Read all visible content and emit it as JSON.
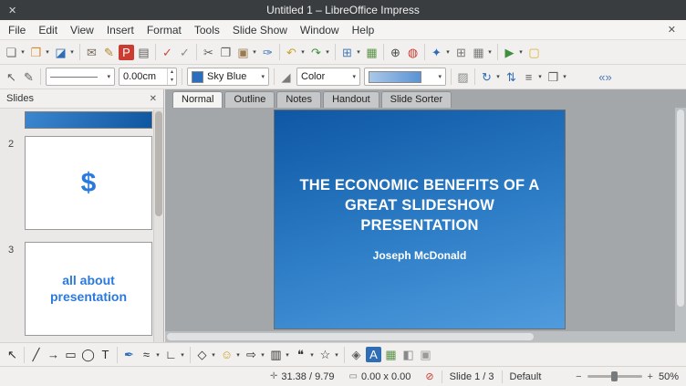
{
  "ui": {
    "caret": "▾",
    "caret_up": "▴"
  },
  "titlebar": {
    "title": "Untitled 1 – LibreOffice Impress",
    "close_glyph": "✕"
  },
  "menubar": {
    "items": [
      "File",
      "Edit",
      "View",
      "Insert",
      "Format",
      "Tools",
      "Slide Show",
      "Window",
      "Help"
    ],
    "close_glyph": "✕"
  },
  "toolbar_standard": {
    "group1": [
      {
        "name": "new-presentation-icon",
        "glyph": "❏",
        "color": "#6d6d6d",
        "caret": true
      },
      {
        "name": "open-icon",
        "glyph": "❒",
        "color": "#d78a2e",
        "caret": true
      },
      {
        "name": "save-icon",
        "glyph": "◪",
        "color": "#2f6db4",
        "caret": true
      }
    ],
    "group2": [
      {
        "name": "email-icon",
        "glyph": "✉",
        "color": "#75695a"
      },
      {
        "name": "edit-file-icon",
        "glyph": "✎",
        "color": "#b5882e"
      },
      {
        "name": "export-pdf-icon",
        "glyph": "P",
        "color": "#ffffff",
        "bg": "#cc3b2f"
      },
      {
        "name": "print-icon",
        "glyph": "▤",
        "color": "#5e5e5e"
      }
    ],
    "group3": [
      {
        "name": "spelling-icon",
        "glyph": "✓",
        "color": "#c04a3a"
      },
      {
        "name": "auto-spellcheck-icon",
        "glyph": "✓",
        "color": "#8a8a8a"
      }
    ],
    "group4": [
      {
        "name": "cut-icon",
        "glyph": "✂",
        "color": "#5e5e5e"
      },
      {
        "name": "copy-icon",
        "glyph": "❐",
        "color": "#5e5e5e"
      },
      {
        "name": "paste-icon",
        "glyph": "▣",
        "color": "#9a7b4f",
        "caret": true
      },
      {
        "name": "clone-formatting-icon",
        "glyph": "✑",
        "color": "#2f6db4"
      }
    ],
    "group5": [
      {
        "name": "undo-icon",
        "glyph": "↶",
        "color": "#c9a227",
        "caret": true
      },
      {
        "name": "redo-icon",
        "glyph": "↷",
        "color": "#3f8f3f",
        "caret": true
      }
    ],
    "group6": [
      {
        "name": "insert-table-icon",
        "glyph": "⊞",
        "color": "#4a7ab5",
        "caret": true
      },
      {
        "name": "insert-image-icon",
        "glyph": "▦",
        "color": "#5d9348"
      }
    ],
    "group7": [
      {
        "name": "zoom-icon",
        "glyph": "⊕",
        "color": "#4a4a4a"
      },
      {
        "name": "gallery-icon",
        "glyph": "◍",
        "color": "#cc3b2f"
      }
    ],
    "group8": [
      {
        "name": "navigator-icon",
        "glyph": "✦",
        "color": "#2f6db4",
        "caret": true
      },
      {
        "name": "display-grid-icon",
        "glyph": "⊞",
        "color": "#7a7a7a"
      },
      {
        "name": "helplines-icon",
        "glyph": "▦",
        "color": "#7a7a7a",
        "caret": true
      }
    ],
    "group9": [
      {
        "name": "start-slideshow-icon",
        "glyph": "▶",
        "color": "#3f8f3f",
        "caret": true
      },
      {
        "name": "insert-comment-icon",
        "glyph": "▢",
        "color": "#d9b036"
      }
    ]
  },
  "toolbar_line_fill": {
    "group1": [
      {
        "name": "select-icon",
        "glyph": "↖",
        "color": "#5e5e5e"
      },
      {
        "name": "edit-points-icon",
        "glyph": "✎",
        "color": "#5e5e5e"
      }
    ],
    "line_width_value": "0.00cm",
    "line_color": {
      "label": "Sky Blue",
      "hex": "#2a6fbf"
    },
    "fill_can_glyph": "◢",
    "fill_type_label": "Color",
    "fill_gradient": {
      "from": "#aac8e8",
      "to": "#5b93d5"
    },
    "group2": [
      {
        "name": "shadow-icon",
        "glyph": "▨",
        "color": "#8a8a8a"
      }
    ],
    "group3": [
      {
        "name": "rotate-icon",
        "glyph": "↻",
        "color": "#2f6db4",
        "caret": true
      },
      {
        "name": "flip-icon",
        "glyph": "⇅",
        "color": "#2f6db4"
      },
      {
        "name": "align-objects-icon",
        "glyph": "≡",
        "color": "#5e5e5e",
        "caret": true
      },
      {
        "name": "arrange-icon",
        "glyph": "❒",
        "color": "#5e5e5e",
        "caret": true
      }
    ],
    "group4": [
      {
        "name": "double-chevron-icon",
        "glyph": "«»",
        "color": "#4a7ab5"
      }
    ]
  },
  "view_tabs": {
    "tabs": [
      "Normal",
      "Outline",
      "Notes",
      "Handout",
      "Slide Sorter"
    ]
  },
  "slides_panel": {
    "title": "Slides",
    "close_glyph": "✕",
    "slide2_number": "2",
    "slide2_text": "$",
    "slide3_number": "3",
    "slide3_text": "all about presentation"
  },
  "slide": {
    "title": "THE ECONOMIC BENEFITS OF A GREAT SLIDESHOW PRESENTATION",
    "subtitle": "Joseph McDonald",
    "gradient_from": "#0e57a4",
    "gradient_to": "#4f9bdd"
  },
  "drawing_toolbar": {
    "group1": [
      {
        "name": "select-arrow-icon",
        "glyph": "↖",
        "color": "#2b2b2b"
      }
    ],
    "group2": [
      {
        "name": "line-icon",
        "glyph": "╱",
        "color": "#2b2b2b"
      },
      {
        "name": "line-arrow-icon",
        "glyph": "→",
        "color": "#2b2b2b"
      },
      {
        "name": "rectangle-icon",
        "glyph": "▭",
        "color": "#2b2b2b"
      },
      {
        "name": "ellipse-icon",
        "glyph": "◯",
        "color": "#2b2b2b"
      },
      {
        "name": "text-box-icon",
        "glyph": "T",
        "color": "#2b2b2b"
      }
    ],
    "group3": [
      {
        "name": "freeform-pen-icon",
        "glyph": "✒",
        "color": "#2f6db4"
      },
      {
        "name": "curve-icon",
        "glyph": "≈",
        "color": "#2b2b2b",
        "caret": true
      },
      {
        "name": "connector-icon",
        "glyph": "∟",
        "color": "#2b2b2b",
        "caret": true
      }
    ],
    "group4": [
      {
        "name": "basic-shapes-icon",
        "glyph": "◇",
        "color": "#2b2b2b",
        "caret": true
      },
      {
        "name": "symbol-shapes-icon",
        "glyph": "☺",
        "color": "#c9a227",
        "caret": true
      },
      {
        "name": "block-arrows-icon",
        "glyph": "⇨",
        "color": "#2b2b2b",
        "caret": true
      },
      {
        "name": "flowchart-icon",
        "glyph": "▥",
        "color": "#2b2b2b",
        "caret": true
      },
      {
        "name": "callouts-icon",
        "glyph": "❝",
        "color": "#2b2b2b",
        "caret": true
      },
      {
        "name": "stars-icon",
        "glyph": "☆",
        "color": "#2b2b2b",
        "caret": true
      }
    ],
    "group5": [
      {
        "name": "edit-points-icon",
        "glyph": "◈",
        "color": "#5e5e5e"
      },
      {
        "name": "fontwork-icon",
        "glyph": "A",
        "color": "#ffffff",
        "bg": "#2f6db4"
      },
      {
        "name": "insert-image-icon",
        "glyph": "▦",
        "color": "#5d9348"
      },
      {
        "name": "extrusion-icon",
        "glyph": "◧",
        "color": "#8a8a8a"
      },
      {
        "name": "interaction-icon",
        "glyph": "▣",
        "color": "#9a9a9a"
      }
    ]
  },
  "statusbar": {
    "position_icon": "✛",
    "position": "31.38 / 9.79",
    "size_icon": "▭",
    "size": "0.00 x 0.00",
    "modified_icon": "⊘",
    "slide_label": "Slide 1 / 3",
    "page_style": "Default",
    "zoom_out": "−",
    "zoom_in": "+",
    "zoom_value": "50%"
  }
}
